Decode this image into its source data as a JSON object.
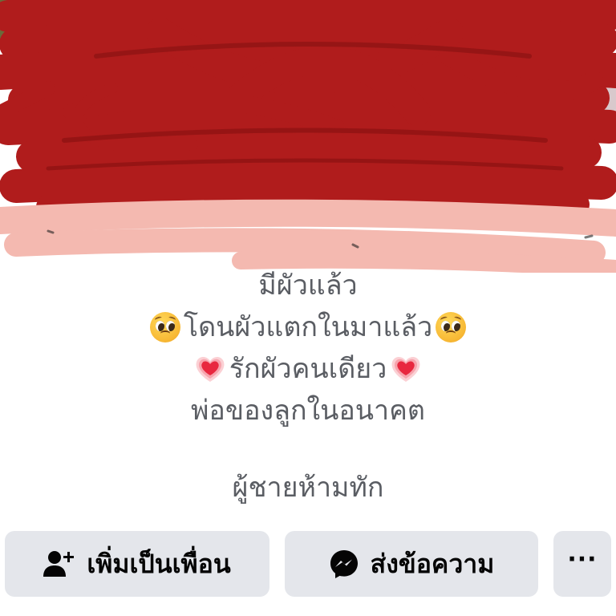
{
  "bio": {
    "line1": "มีผัวแล้ว",
    "line2": "โดนผัวแตกในมาแล้ว",
    "line3": "รักผัวคนเดียว",
    "line4": "พ่อของลูกในอนาคต",
    "line5": "ผู้ชายห้ามทัก",
    "line2_emoji": "pleading-face-emoji",
    "line3_emoji": "growing-heart-emoji"
  },
  "actions": {
    "add_friend_label": "เพิ่มเป็นเพื่อน",
    "add_friend_icon": "add-friend-icon",
    "message_label": "ส่งข้อความ",
    "message_icon": "messenger-icon",
    "more_label": "···"
  },
  "colors": {
    "button_bg": "#e4e6eb",
    "bio_text": "#5a5d63",
    "redaction_red": "#b01c1c",
    "redaction_pink": "#f4b9b0"
  }
}
